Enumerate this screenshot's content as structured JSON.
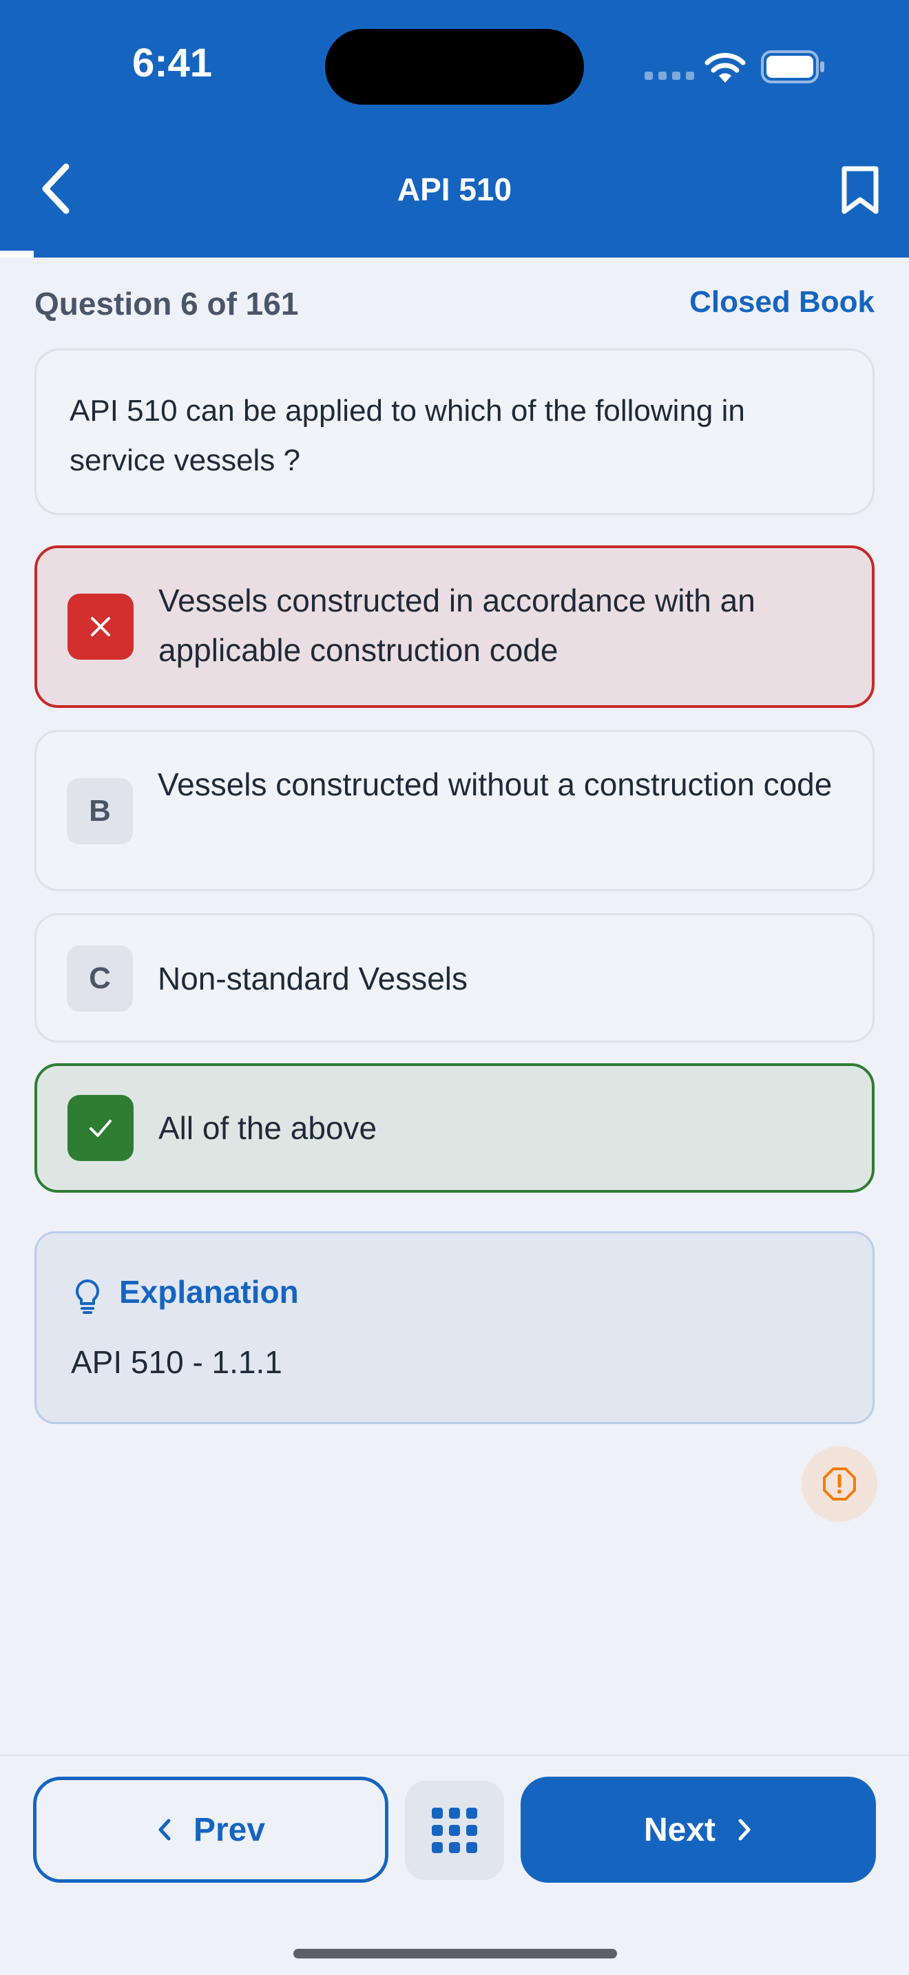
{
  "status_bar": {
    "time": "6:41"
  },
  "header": {
    "title": "API 510",
    "back_icon": "chevron-left-icon",
    "bookmark_icon": "bookmark-icon"
  },
  "progress": {
    "current": 6,
    "total": 161
  },
  "quiz": {
    "counter": "Question 6 of 161",
    "mode": "Closed Book",
    "question": "API 510 can be applied to which of the following in service vessels ?",
    "options": [
      {
        "badge": "",
        "text": "Vessels constructed in accordance with an applicable construction code",
        "state": "wrong",
        "icon": "close-icon"
      },
      {
        "badge": "B",
        "text": "Vessels constructed without a construction code",
        "state": "neutral"
      },
      {
        "badge": "C",
        "text": "Non-standard Vessels",
        "state": "neutral"
      },
      {
        "badge": "",
        "text": "All of the above",
        "state": "correct",
        "icon": "check-icon"
      }
    ]
  },
  "explanation": {
    "title": "Explanation",
    "text": "API 510 - 1.1.1",
    "icon": "lightbulb-icon"
  },
  "report_icon": "alert-octagon-icon",
  "footer": {
    "prev_label": "Prev",
    "next_label": "Next",
    "grid_icon": "grid-icon"
  },
  "colors": {
    "primary": "#1565C0",
    "wrong": "#C62828",
    "correct": "#2E7D32",
    "warning": "#F57C00",
    "background": "#EEF1F7"
  }
}
